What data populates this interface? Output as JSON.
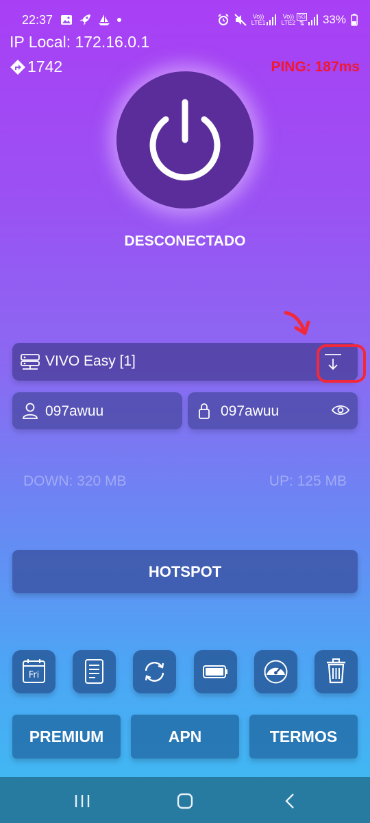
{
  "status_bar": {
    "time": "22:37",
    "sim1": {
      "top": "Vo))",
      "bottom": "LTE1"
    },
    "sim2": {
      "top": "Vo))",
      "bottom": "LTE2"
    },
    "network": "5G",
    "battery": "33%",
    "left_icons": [
      "image-icon",
      "rocket-icon",
      "sailboat-icon",
      "dot-icon"
    ],
    "right_icons": [
      "alarm-icon",
      "mute-icon",
      "signal-icon",
      "battery-icon"
    ]
  },
  "header": {
    "ip_local": "IP Local: 172.16.0.1",
    "counter": "1742",
    "ping": "PING: 187ms"
  },
  "power": {
    "status": "DESCONECTADO"
  },
  "server": {
    "name": "VIVO Easy [1]"
  },
  "credentials": {
    "username": "097awuu",
    "password": "097awuu"
  },
  "traffic": {
    "down": "DOWN: 320 MB",
    "up": "UP: 125 MB"
  },
  "hotspot_label": "HOTSPOT",
  "tools": {
    "calendar_label": "Fri",
    "icons": [
      "calendar-icon",
      "document-icon",
      "refresh-icon",
      "battery-icon",
      "speedometer-icon",
      "trash-icon"
    ]
  },
  "bottom_buttons": [
    "PREMIUM",
    "APN",
    "TERMOS"
  ],
  "colors": {
    "ping_red": "#f01832",
    "annotation_red": "#f2293a",
    "power_circle": "#5a2d9a",
    "nav_bar": "#277aa0"
  }
}
